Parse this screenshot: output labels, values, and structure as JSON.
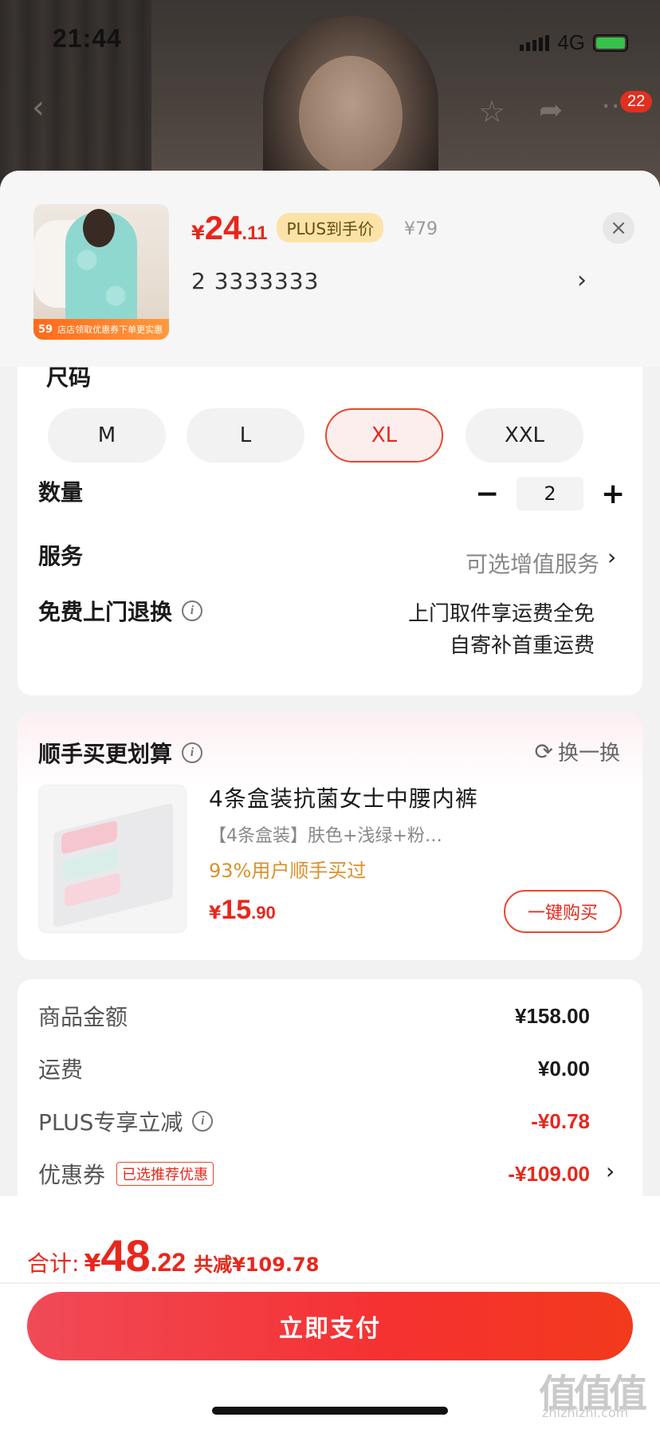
{
  "status_bar": {
    "time": "21:44",
    "network": "4G"
  },
  "nav": {
    "back_icon": "chevron-left-icon",
    "star_icon": "star-icon",
    "share_icon": "share-icon",
    "more_icon": "more-icon",
    "badge_count": "22"
  },
  "product": {
    "thumb_label_price": "59",
    "thumb_label_text": "店店领取优惠券下单更实惠",
    "price_symbol": "¥",
    "price_int": "24",
    "price_dec": ".11",
    "plus_tag": "PLUS到手价",
    "original_price": "¥79",
    "selected_spec": "2  3333333",
    "close_icon": "×"
  },
  "options": {
    "size_title": "尺码",
    "sizes": [
      "M",
      "L",
      "XL",
      "XXL"
    ],
    "selected_size": "XL",
    "quantity_label": "数量",
    "quantity": "2",
    "minus": "−",
    "plus": "+",
    "service_label": "服务",
    "service_value": "可选增值服务",
    "return_label": "免费上门退换",
    "return_line1": "上门取件享运费全免",
    "return_line2": "自寄补首重运费"
  },
  "upsell": {
    "title": "顺手买更划算",
    "refresh_label": "换一换",
    "name": "4条盒装抗菌女士中腰内裤",
    "desc": "【4条盒装】肤色+浅绿+粉…",
    "bought": "93%用户顺手买过",
    "price_symbol": "¥",
    "price_int": "15",
    "price_dec": ".90",
    "buy_label": "一键购买"
  },
  "summary": {
    "goods_label": "商品金额",
    "goods_value": "¥158.00",
    "shipping_label": "运费",
    "shipping_value": "¥0.00",
    "plus_label": "PLUS专享立减",
    "plus_value": "-¥0.78",
    "coupon_label": "优惠券",
    "coupon_tag": "已选推荐优惠",
    "coupon_value": "-¥109.00"
  },
  "footer": {
    "total_label": "合计:",
    "total_symbol": "¥",
    "total_int": "48",
    "total_dec": ".22",
    "total_saved": "共减¥109.78",
    "pay_label": "立即支付"
  },
  "watermark": {
    "text": "值值值",
    "sub": "zhizhizhi.com"
  },
  "colors": {
    "accent": "#e8271c",
    "plus_tag_bg": "#fbe3a8",
    "bought": "#d9912a"
  }
}
